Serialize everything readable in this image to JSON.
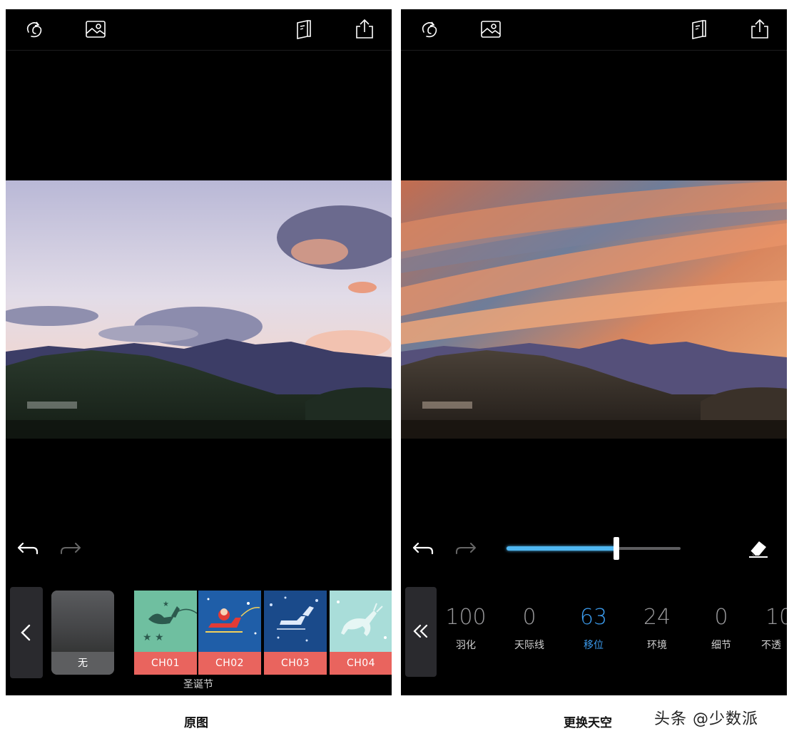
{
  "left_panel": {
    "thumbnails": {
      "none_label": "无",
      "items": [
        {
          "label": "CH01"
        },
        {
          "label": "CH02"
        },
        {
          "label": "CH03"
        },
        {
          "label": "CH04"
        }
      ],
      "group_label": "圣诞节"
    },
    "caption": "原图"
  },
  "right_panel": {
    "slider": {
      "value_fraction": 0.63,
      "fill_color": "#4fb7f2"
    },
    "params": [
      {
        "value": "100",
        "label": "羽化",
        "active": false
      },
      {
        "value": "0",
        "label": "天际线",
        "active": false
      },
      {
        "value": "63",
        "label": "移位",
        "active": true
      },
      {
        "value": "24",
        "label": "环境",
        "active": false
      },
      {
        "value": "0",
        "label": "细节",
        "active": false
      },
      {
        "value": "10",
        "label": "不透",
        "active": false
      }
    ],
    "active_color": "#3c9df0",
    "caption": "更换天空"
  },
  "watermark": "头条 @少数派",
  "icons": {
    "toolbar": [
      "sky-swap-icon",
      "image-icon",
      "book-icon",
      "share-icon"
    ],
    "history": [
      "undo-icon",
      "redo-icon"
    ],
    "tools": [
      "eraser-icon",
      "double-chevron-left-icon",
      "chevron-left-icon"
    ]
  }
}
